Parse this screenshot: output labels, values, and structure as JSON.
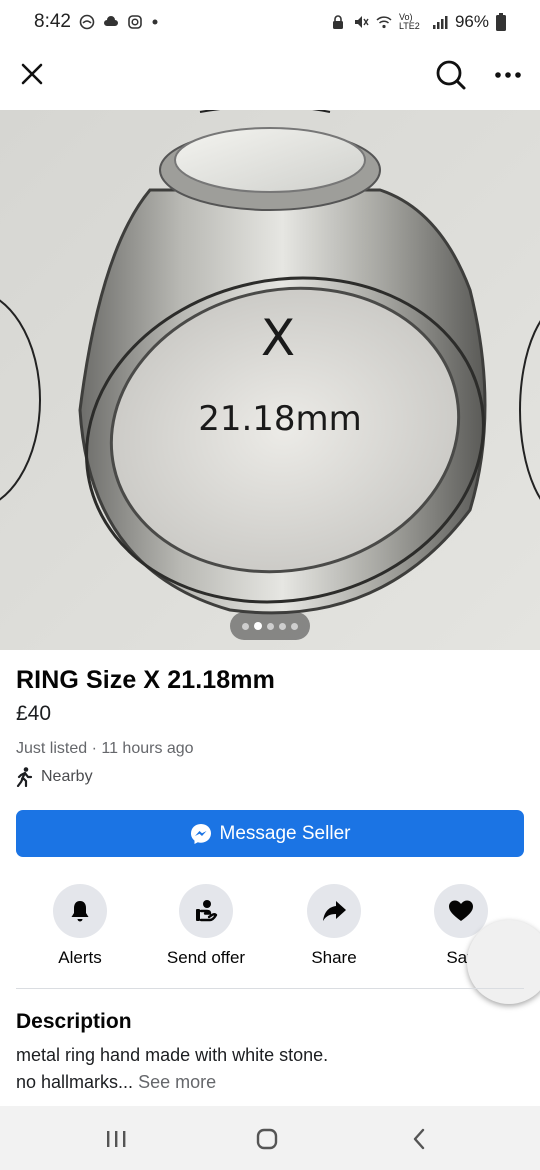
{
  "status": {
    "time": "8:42",
    "signal_text": "Vo) LTE2",
    "battery": "96%"
  },
  "header": {
    "close_icon": "close-icon",
    "search_icon": "search-icon",
    "more_icon": "more-icon"
  },
  "listing": {
    "photo_text_size": "X",
    "photo_text_mm": "21.18mm",
    "carousel_count": 5,
    "carousel_active": 2,
    "title": "RING Size X 21.18mm",
    "price": "£40",
    "listed": "Just listed · 11 hours ago",
    "location": "Nearby"
  },
  "message_button": {
    "label": "Message Seller"
  },
  "actions": [
    {
      "label": "Alerts",
      "icon": "bell-icon"
    },
    {
      "label": "Send offer",
      "icon": "offer-icon"
    },
    {
      "label": "Share",
      "icon": "share-icon"
    },
    {
      "label": "Sav",
      "icon": "heart-icon"
    }
  ],
  "description": {
    "heading": "Description",
    "line1": "metal ring hand made with white stone.",
    "line2": "no hallmarks...",
    "see_more": "See more"
  },
  "colors": {
    "accent": "#1b74e4",
    "secondary_text": "#65676b",
    "button_bg": "#e4e6eb"
  }
}
